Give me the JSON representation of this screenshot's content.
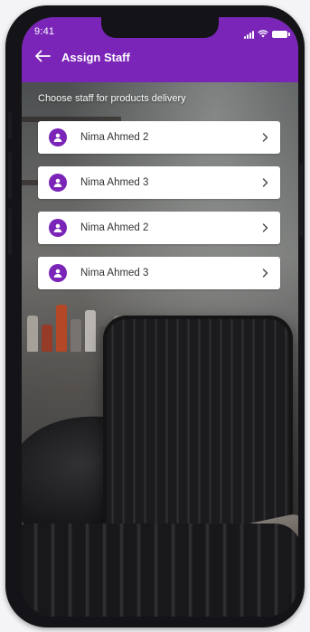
{
  "status_bar": {
    "time": "9:41"
  },
  "header": {
    "title": "Assign Staff"
  },
  "main": {
    "subtitle": "Choose staff for products delivery",
    "staff": [
      {
        "name": "Nima Ahmed 2"
      },
      {
        "name": "Nima Ahmed 3"
      },
      {
        "name": "Nima Ahmed 2"
      },
      {
        "name": "Nima Ahmed 3"
      }
    ]
  },
  "colors": {
    "accent": "#7a25b8",
    "card": "#ffffff",
    "text": "#333336"
  },
  "icons": {
    "back": "arrow-left-icon",
    "avatar": "user-avatar-icon",
    "row_action": "chevron-right-icon",
    "signal": "signal-icon",
    "wifi": "wifi-icon",
    "battery": "battery-icon"
  }
}
